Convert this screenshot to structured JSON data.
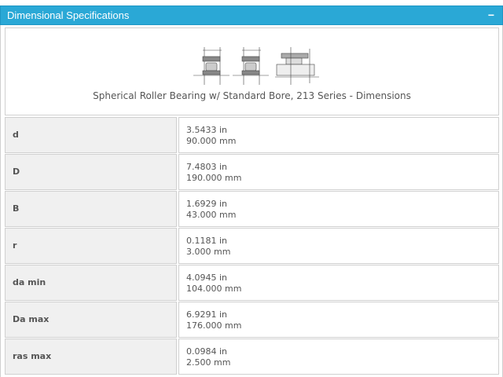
{
  "panel": {
    "title": "Dimensional Specifications",
    "collapse_icon": "minus-icon"
  },
  "figure": {
    "caption": "Spherical Roller Bearing w/ Standard Bore, 213 Series - Dimensions"
  },
  "rows": [
    {
      "label": "d",
      "in": "3.5433 in",
      "mm": "90.000 mm"
    },
    {
      "label": "D",
      "in": "7.4803 in",
      "mm": "190.000 mm"
    },
    {
      "label": "B",
      "in": "1.6929 in",
      "mm": "43.000 mm"
    },
    {
      "label": "r",
      "in": "0.1181 in",
      "mm": "3.000 mm"
    },
    {
      "label": "da min",
      "in": "4.0945 in",
      "mm": "104.000 mm"
    },
    {
      "label": "Da max",
      "in": "6.9291 in",
      "mm": "176.000 mm"
    },
    {
      "label": "ras max",
      "in": "0.0984 in",
      "mm": "2.500 mm"
    }
  ],
  "colors": {
    "header_bg": "#2aa8d6",
    "label_bg": "#f0f0f0",
    "border": "#d0d0d0",
    "text": "#555555"
  }
}
